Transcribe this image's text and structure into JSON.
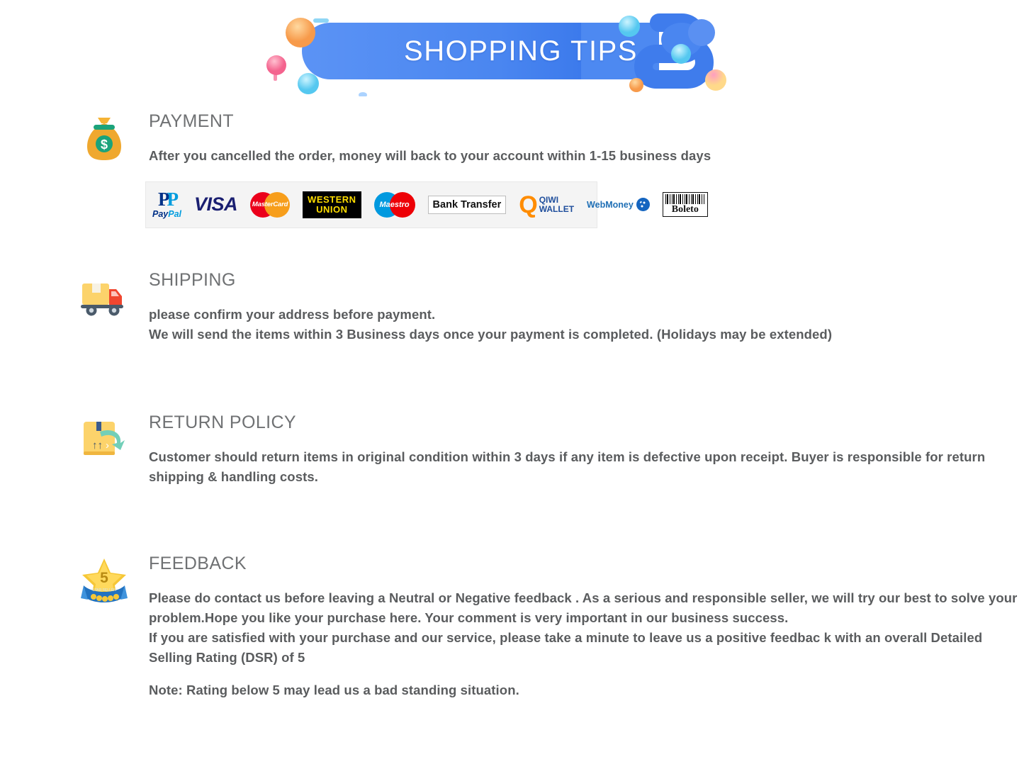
{
  "banner": {
    "title": "SHOPPING TIPS",
    "accent_color": "#4a86f0",
    "title_color": "#ffffff"
  },
  "sections": [
    {
      "id": "payment",
      "icon": "money-bag-icon",
      "heading": "PAYMENT",
      "lines": [
        "After you cancelled the order, money will back to your account within 1-15 business days"
      ]
    },
    {
      "id": "shipping",
      "icon": "delivery-truck-icon",
      "heading": "SHIPPING",
      "lines": [
        "please confirm your address before payment.",
        "We will send the items within 3 Business days once your payment is completed. (Holidays may be extended)"
      ]
    },
    {
      "id": "return",
      "icon": "return-box-icon",
      "heading": "RETURN POLICY",
      "lines": [
        "Customer should return items in original condition within 3 days if any item is defective upon receipt. Buyer is responsible for return shipping & handling costs."
      ]
    },
    {
      "id": "feedback",
      "icon": "five-star-badge-icon",
      "heading": "FEEDBACK",
      "lines": [
        "Please do contact us before leaving a Neutral or Negative  feedback . As a serious and responsible seller, we will try our  best to solve your problem.Hope you like your purchase here. Your comment is very important in our business success.",
        " If you are satisfied with your purchase and our service,  please take a minute to leave us  a positive feedbac k with an overall  Detailed Selling Rating (DSR) of 5",
        "Note: Rating below 5 may lead us a bad standing situation."
      ]
    }
  ],
  "payment_methods": [
    {
      "name": "paypal",
      "label": "PayPal"
    },
    {
      "name": "visa",
      "label": "VISA"
    },
    {
      "name": "mastercard",
      "label": "MasterCard"
    },
    {
      "name": "western-union",
      "label_top": "WESTERN",
      "label_bottom": "UNION"
    },
    {
      "name": "maestro",
      "label": "Maestro"
    },
    {
      "name": "bank-transfer",
      "label": "Bank Transfer"
    },
    {
      "name": "qiwi-wallet",
      "label_top": "QIWI",
      "label_bottom": "WALLET",
      "mark": "Q"
    },
    {
      "name": "webmoney",
      "label": "WebMoney"
    },
    {
      "name": "boleto",
      "label": "Boleto"
    }
  ]
}
